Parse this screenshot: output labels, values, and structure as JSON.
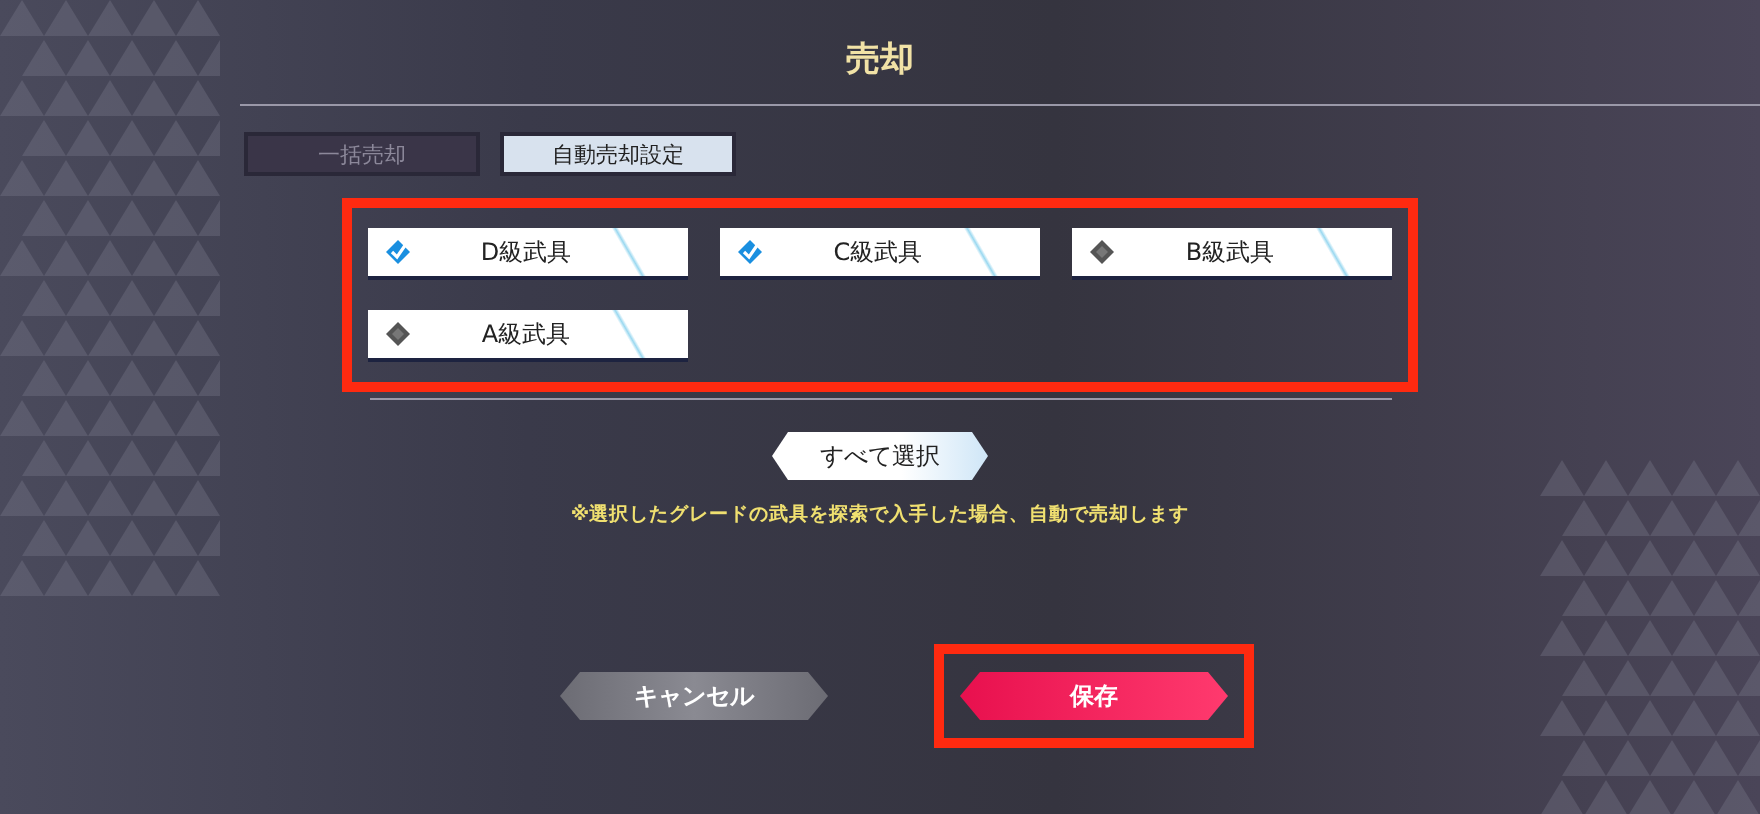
{
  "title": "売却",
  "tabs": [
    {
      "label": "一括売却",
      "selected": false
    },
    {
      "label": "自動売却設定",
      "selected": true
    }
  ],
  "grades": {
    "highlighted": true,
    "items": [
      {
        "label": "D級武具",
        "checked": true
      },
      {
        "label": "C級武具",
        "checked": true
      },
      {
        "label": "B級武具",
        "checked": false
      },
      {
        "label": "A級武具",
        "checked": false
      }
    ]
  },
  "select_all": "すべて選択",
  "note": "※選択したグレードの武具を探索で入手した場合、自動で売却します",
  "buttons": [
    {
      "label": "キャンセル",
      "kind": "secondary",
      "highlighted": false
    },
    {
      "label": "保存",
      "kind": "primary",
      "highlighted": true
    }
  ]
}
